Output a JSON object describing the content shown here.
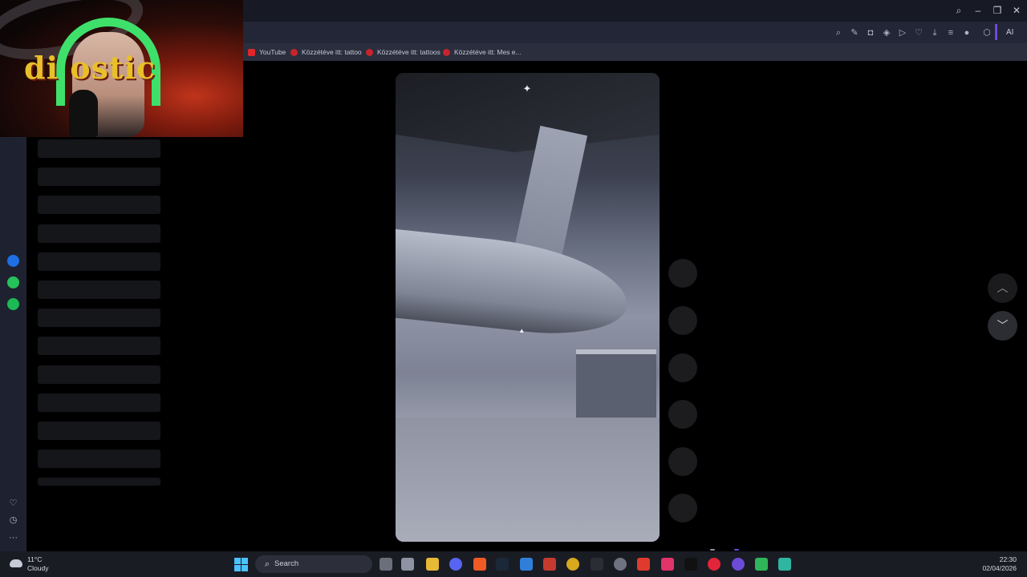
{
  "bookmarks": [
    {
      "label": "YouTube",
      "icon": "youtube-icon"
    },
    {
      "label": "Közzétéve itt: tattoo",
      "icon": "pinterest-icon"
    },
    {
      "label": "Közzétéve itt: tattoos",
      "icon": "pinterest-icon"
    },
    {
      "label": "Közzétéve itt: Mes e...",
      "icon": "pinterest-icon"
    }
  ],
  "toolbar": {
    "ai_label": "AI"
  },
  "webcam": {
    "overlay_text": "di   ostic"
  },
  "taskbar": {
    "weather": {
      "temp": "11°C",
      "desc": "Cloudy"
    },
    "search_label": "Search",
    "time": "22:30",
    "date": "02/04/2026"
  },
  "colors": {
    "accent": "#6b4bd8",
    "start": "#4cc2ff",
    "headset": "#3ee06a"
  }
}
